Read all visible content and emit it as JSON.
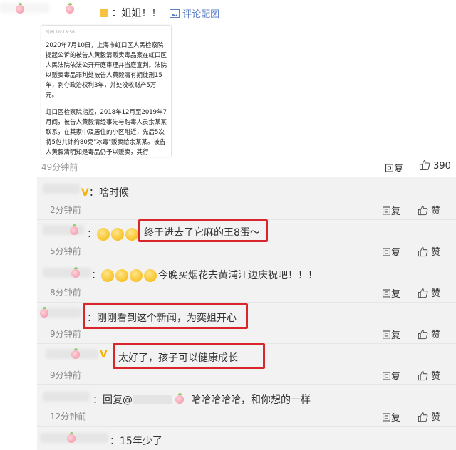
{
  "top_comment": {
    "text": "：姐姐！！",
    "image_link": "评论配图",
    "time": "49分钟前",
    "reply_label": "回复",
    "like_count": "390",
    "document": {
      "header": "时间 10:18:56",
      "para1": "2020年7月10日，上海市虹口区人民检察院提起公诉的被告人黄毅清贩卖毒品案在虹口区人民法院依法公开开庭审理并当庭宣判。法院以贩卖毒品罪判处被告人黄毅清有期徒刑15年，剥夺政治权利3年，并处没收财产5万元。",
      "para2": "虹口区检察院指控，2018年12月至2019年7月间，被告人黄毅清经事先与购毒人员余某某联系，在其家中及居住的小区附近，先后5次将5包共计约80克\"冰毒\"贩卖给余某某。被告人黄毅清明知是毒品仍予以贩卖，其行"
    }
  },
  "replies": [
    {
      "text": "啥时候",
      "time": "2分钟前",
      "reply_label": "回复",
      "like_label": "赞"
    },
    {
      "text": "终于进去了它麻的王8蛋～",
      "time": "5分钟前",
      "reply_label": "回复",
      "like_label": "赞"
    },
    {
      "text": "今晚买烟花去黄浦江边庆祝吧！！！",
      "time": "8分钟前",
      "reply_label": "回复",
      "like_label": "赞"
    },
    {
      "text": "刚刚看到这个新闻，为奕姐开心",
      "time": "9分钟前",
      "reply_label": "回复",
      "like_label": "赞"
    },
    {
      "text": "太好了，孩子可以健康成长",
      "time": "9分钟前",
      "reply_label": "回复",
      "like_label": "赞"
    },
    {
      "prefix": "回复@",
      "text": "哈哈哈哈哈，和你想的一样",
      "time": "12分钟前",
      "reply_label": "回复",
      "like_label": "赞"
    },
    {
      "text": "15年少了"
    }
  ],
  "colors": {
    "highlight_box": "#d9262d",
    "link": "#5b7fc5",
    "vip_badge": "#f2b400",
    "reply_bg": "#f2f2f2"
  },
  "icons": [
    "image-icon",
    "thumbs-up-icon",
    "v-badge-icon",
    "emoji-icon"
  ]
}
